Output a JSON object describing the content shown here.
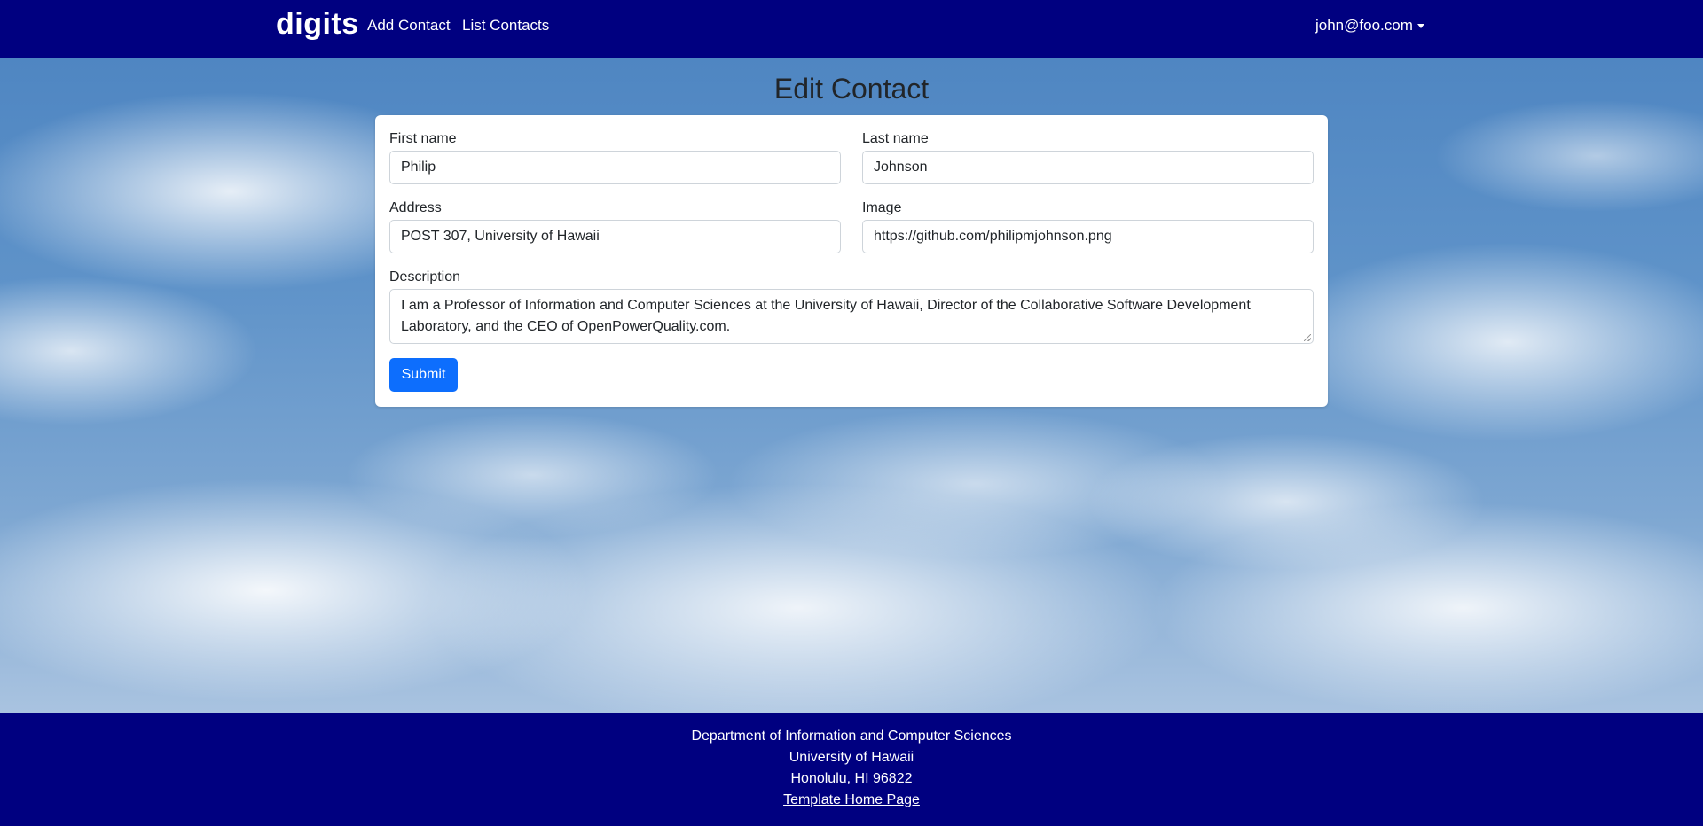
{
  "navbar": {
    "brand": "digits",
    "links": [
      {
        "label": "Add Contact"
      },
      {
        "label": "List Contacts"
      }
    ],
    "user": "john@foo.com"
  },
  "main": {
    "title": "Edit Contact",
    "form": {
      "first_name": {
        "label": "First name",
        "value": "Philip"
      },
      "last_name": {
        "label": "Last name",
        "value": "Johnson"
      },
      "address": {
        "label": "Address",
        "value": "POST 307, University of Hawaii"
      },
      "image": {
        "label": "Image",
        "value": "https://github.com/philipmjohnson.png"
      },
      "description": {
        "label": "Description",
        "value": "I am a Professor of Information and Computer Sciences at the University of Hawaii, Director of the Collaborative Software Development Laboratory, and the CEO of OpenPowerQuality.com."
      },
      "submit_label": "Submit"
    }
  },
  "footer": {
    "lines": [
      "Department of Information and Computer Sciences",
      "University of Hawaii",
      "Honolulu, HI 96822"
    ],
    "link": "Template Home Page"
  },
  "colors": {
    "navbar_bg": "#000080",
    "primary_button": "#0d6efd"
  }
}
